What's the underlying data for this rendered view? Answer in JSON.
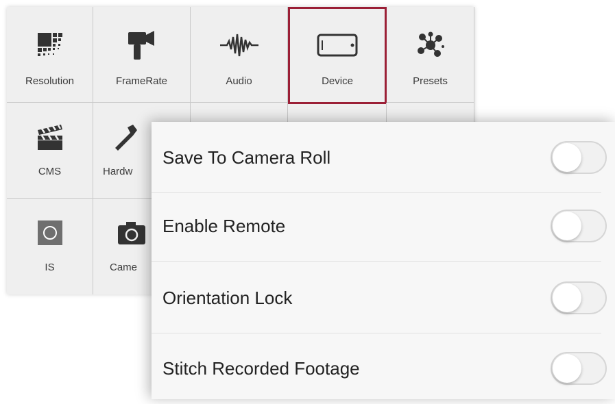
{
  "grid": {
    "row1": [
      "Resolution",
      "FrameRate",
      "Audio",
      "Device",
      "Presets"
    ],
    "row2": [
      "CMS",
      "Hardw"
    ],
    "row3": [
      "IS",
      "Came"
    ]
  },
  "selected_tab": "Device",
  "accent_color": "#9b1f36",
  "settings": [
    {
      "label": "Save To Camera Roll",
      "enabled": false
    },
    {
      "label": "Enable Remote",
      "enabled": false
    },
    {
      "label": "Orientation Lock",
      "enabled": false
    },
    {
      "label": "Stitch Recorded Footage",
      "enabled": false
    }
  ]
}
